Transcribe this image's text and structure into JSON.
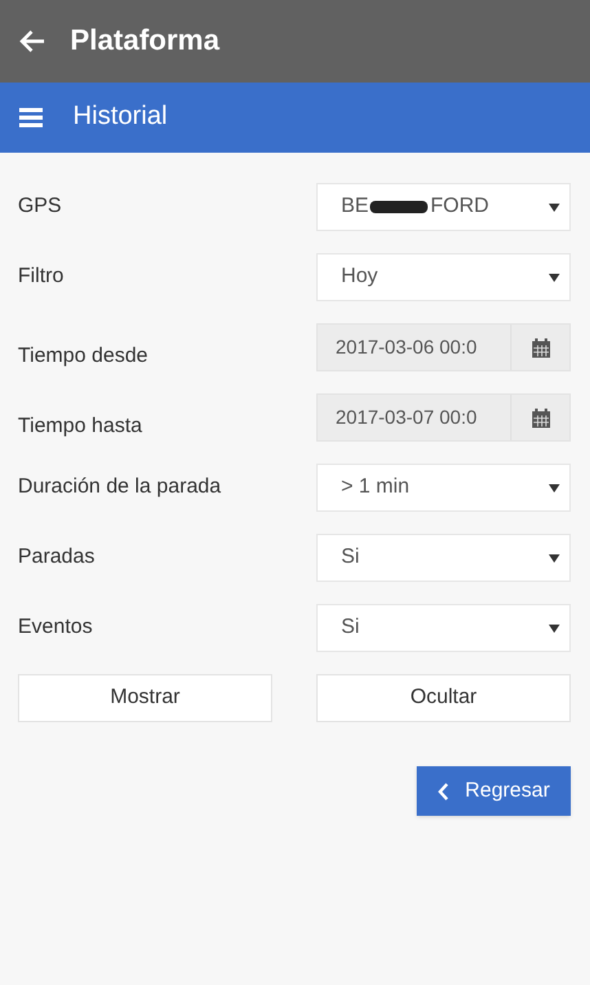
{
  "app_bar": {
    "title": "Plataforma"
  },
  "section_bar": {
    "title": "Historial"
  },
  "fields": [
    {
      "label": "GPS",
      "kind": "select",
      "value_parts": [
        "BE",
        "FORD"
      ],
      "redacted": true
    },
    {
      "label": "Filtro",
      "kind": "select",
      "value": "Hoy"
    },
    {
      "label": "Tiempo desde",
      "kind": "date",
      "value": "2017-03-06 00:0"
    },
    {
      "label": "Tiempo hasta",
      "kind": "date",
      "value": "2017-03-07 00:0"
    },
    {
      "label": "Duración de la parada",
      "kind": "select",
      "value": "> 1 min"
    },
    {
      "label": "Paradas",
      "kind": "select",
      "value": "Si"
    },
    {
      "label": "Eventos",
      "kind": "select",
      "value": "Si"
    }
  ],
  "buttons": [
    "Mostrar",
    "Ocultar"
  ],
  "back_button": {
    "label": "Regresar"
  }
}
